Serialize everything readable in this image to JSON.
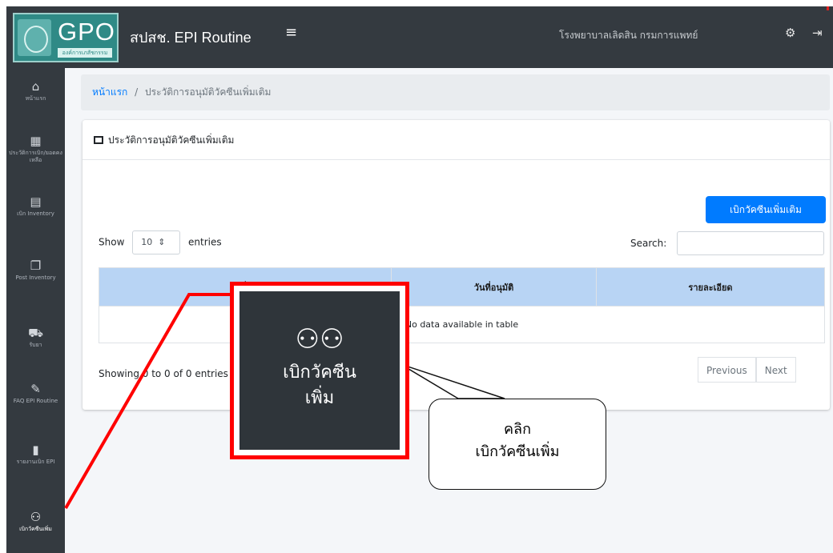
{
  "header": {
    "logo_text": "GPO",
    "logo_subtext": "องค์การเภสัชกรรม",
    "app_title": "สปสช. EPI Routine",
    "menu_toggle": "≡",
    "user_name": "โรงพยาบาลเลิดสิน กรมการแพทย์",
    "settings_icon": "⚙",
    "logout_icon": "⇥"
  },
  "sidebar": {
    "items": [
      {
        "icon": "home-icon",
        "glyph": "⌂",
        "label": "หน้าแรก"
      },
      {
        "icon": "calendar-icon",
        "glyph": "▦",
        "label": "ประวัติการเบิก/ยอดคงเหลือ"
      },
      {
        "icon": "inventory-icon",
        "glyph": "▤",
        "label": "เบิก Inventory"
      },
      {
        "icon": "copy-icon",
        "glyph": "❐",
        "label": "Post Inventory"
      },
      {
        "icon": "truck-icon",
        "glyph": "⛟",
        "label": "รับยา"
      },
      {
        "icon": "syringe-icon",
        "glyph": "✎",
        "label": "FAQ EPI Routine"
      },
      {
        "icon": "file-icon",
        "glyph": "▮",
        "label": "รายงานเบิก EPI"
      },
      {
        "icon": "people-carry-icon",
        "glyph": "⚇",
        "label": "เบิกวัคซีนเพิ่ม"
      }
    ]
  },
  "breadcrumb": {
    "home": "หน้าแรก",
    "separator": "/",
    "current": "ประวัติการอนุมัติวัคซีนเพิ่มเติม"
  },
  "card": {
    "title": "ประวัติการอนุมัติวัคซีนเพิ่มเติม",
    "add_button": "เบิกวัคซีนเพิ่มเติม",
    "show_label": "Show",
    "entries_value": "10",
    "entries_label": "entries",
    "search_label": "Search:",
    "columns": [
      "วันที่เบิก",
      "วันที่อนุมัติ",
      "รายละเอียด"
    ],
    "empty_text": "No data available in table",
    "info_text": "Showing 0 to 0 of 0 entries",
    "prev": "Previous",
    "next": "Next"
  },
  "annotation": {
    "zoom_icon": "people-carry-icon",
    "zoom_label_line1": "เบิกวัคซีน",
    "zoom_label_line2": "เพิ่ม",
    "callout_line1": "คลิก",
    "callout_line2": "เบิกวัคซีนเพิ่ม",
    "highlight_color": "#ff0000"
  }
}
